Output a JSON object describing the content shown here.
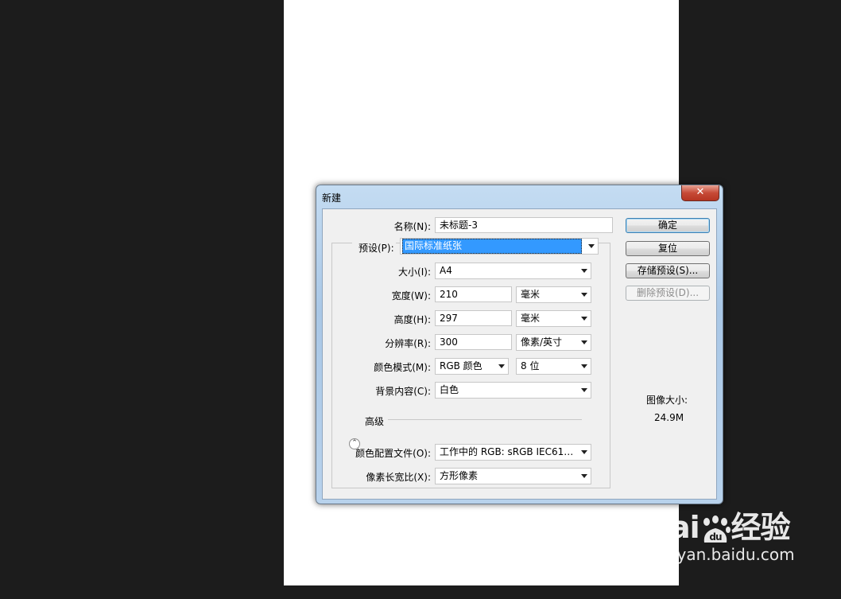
{
  "dialog": {
    "title": "新建",
    "close_symbol": "✕",
    "name_label": "名称(N):",
    "name_value": "未标题-3",
    "preset_label": "预设(P):",
    "preset_value": "国际标准纸张",
    "size_label": "大小(I):",
    "size_value": "A4",
    "width_label": "宽度(W):",
    "width_value": "210",
    "width_unit": "毫米",
    "height_label": "高度(H):",
    "height_value": "297",
    "height_unit": "毫米",
    "resolution_label": "分辨率(R):",
    "resolution_value": "300",
    "resolution_unit": "像素/英寸",
    "color_mode_label": "颜色模式(M):",
    "color_mode_value": "RGB 颜色",
    "bit_depth_value": "8 位",
    "background_label": "背景内容(C):",
    "background_value": "白色",
    "advanced_label": "高级",
    "color_profile_label": "颜色配置文件(O):",
    "color_profile_value": "工作中的 RGB: sRGB IEC6196...",
    "pixel_aspect_label": "像素长宽比(X):",
    "pixel_aspect_value": "方形像素",
    "buttons": {
      "ok": "确定",
      "reset": "复位",
      "save_preset": "存储预设(S)...",
      "delete_preset": "删除预设(D)..."
    },
    "image_size_label": "图像大小:",
    "image_size_value": "24.9M"
  },
  "watermark": {
    "brand_left": "Bai",
    "brand_mid": "du",
    "brand_right": "经验",
    "url": "jingyan.baidu.com"
  }
}
